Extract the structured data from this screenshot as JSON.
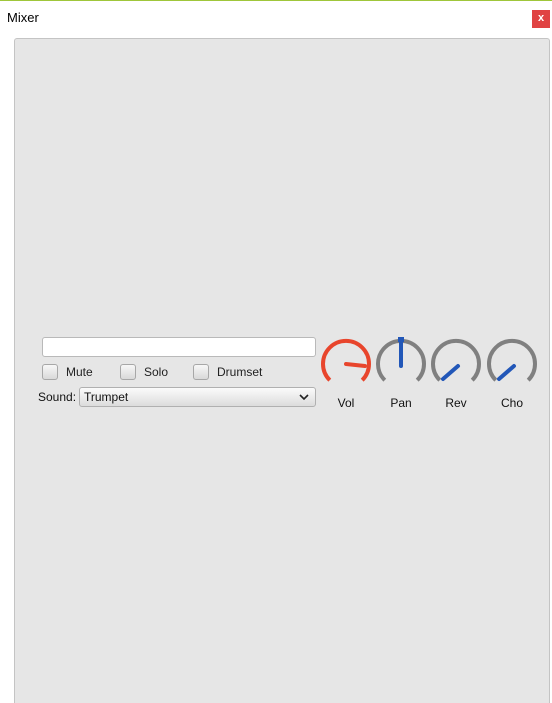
{
  "window": {
    "title": "Mixer",
    "close_label": "x"
  },
  "channel": {
    "name_value": "",
    "checkboxes": [
      {
        "label": "Mute",
        "checked": false
      },
      {
        "label": "Solo",
        "checked": false
      },
      {
        "label": "Drumset",
        "checked": false
      }
    ],
    "sound_label": "Sound:",
    "sound_value": "Trumpet"
  },
  "knobs": [
    {
      "label": "Vol",
      "color": "#e8452c",
      "style": "volume"
    },
    {
      "label": "Pan",
      "color": "#2257b8",
      "style": "pan"
    },
    {
      "label": "Rev",
      "color": "#2257b8",
      "style": "low"
    },
    {
      "label": "Cho",
      "color": "#2257b8",
      "style": "low"
    }
  ],
  "colors": {
    "panel_bg": "#e6e6e6",
    "ring_gray": "#808080",
    "close_bg": "#e04343"
  }
}
